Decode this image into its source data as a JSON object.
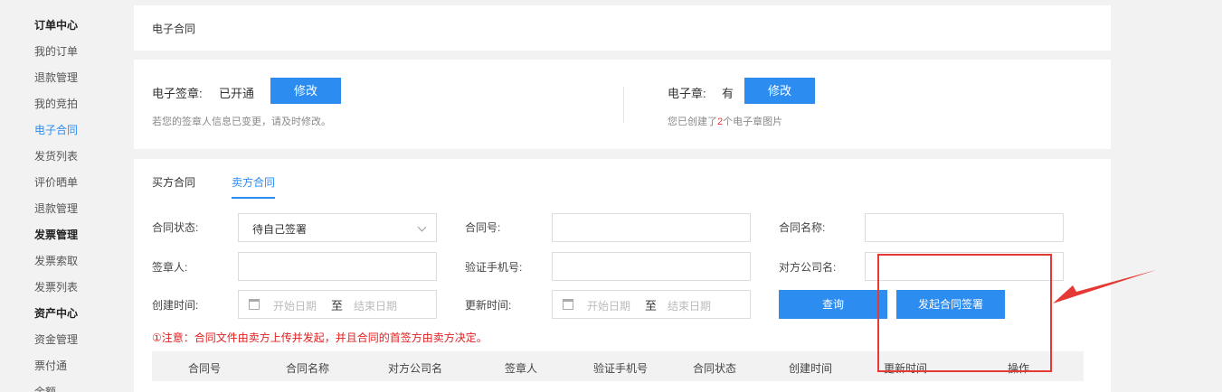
{
  "sidebar": {
    "items": [
      {
        "label": "订单中心",
        "kind": "header"
      },
      {
        "label": "我的订单",
        "kind": "link"
      },
      {
        "label": "退款管理",
        "kind": "link"
      },
      {
        "label": "我的竞拍",
        "kind": "link"
      },
      {
        "label": "电子合同",
        "kind": "active"
      },
      {
        "label": "发货列表",
        "kind": "link"
      },
      {
        "label": "评价晒单",
        "kind": "link"
      },
      {
        "label": "退款管理",
        "kind": "link"
      },
      {
        "label": "发票管理",
        "kind": "header"
      },
      {
        "label": "发票索取",
        "kind": "link"
      },
      {
        "label": "发票列表",
        "kind": "link"
      },
      {
        "label": "资产中心",
        "kind": "header"
      },
      {
        "label": "资金管理",
        "kind": "link"
      },
      {
        "label": "票付通",
        "kind": "link"
      },
      {
        "label": "余额",
        "kind": "link"
      }
    ]
  },
  "page_title": "电子合同",
  "signature": {
    "label": "电子签章:",
    "status": "已开通",
    "edit_button": "修改",
    "hint": "若您的签章人信息已变更，请及时修改。"
  },
  "seal": {
    "label": "电子章:",
    "status": "有",
    "edit_button": "修改",
    "hint_prefix": "您已创建了",
    "hint_count": "2",
    "hint_suffix": "个电子章图片"
  },
  "tabs": [
    "买方合同",
    "卖方合同"
  ],
  "active_tab": "卖方合同",
  "filters": {
    "contract_status": {
      "label": "合同状态:",
      "value": "待自己签署"
    },
    "contract_no": {
      "label": "合同号:",
      "value": ""
    },
    "contract_name": {
      "label": "合同名称:",
      "value": ""
    },
    "signer": {
      "label": "签章人:",
      "value": ""
    },
    "verify_phone": {
      "label": "验证手机号:",
      "value": ""
    },
    "counterparty": {
      "label": "对方公司名:",
      "value": ""
    },
    "created_time": {
      "label": "创建时间:",
      "start_placeholder": "开始日期",
      "separator": "至",
      "end_placeholder": "结束日期"
    },
    "updated_time": {
      "label": "更新时间:",
      "start_placeholder": "开始日期",
      "separator": "至",
      "end_placeholder": "结束日期"
    }
  },
  "buttons": {
    "query": "查询",
    "initiate_sign": "发起合同签署"
  },
  "notice": "①注意：合同文件由卖方上传并发起，并且合同的首签方由卖方决定。",
  "table": {
    "headers": [
      "合同号",
      "合同名称",
      "对方公司名",
      "签章人",
      "验证手机号",
      "合同状态",
      "创建时间",
      "更新时间",
      "操作"
    ]
  },
  "colors": {
    "accent": "#2d8cf0",
    "notice": "#e02020",
    "annotation": "#e53935"
  }
}
